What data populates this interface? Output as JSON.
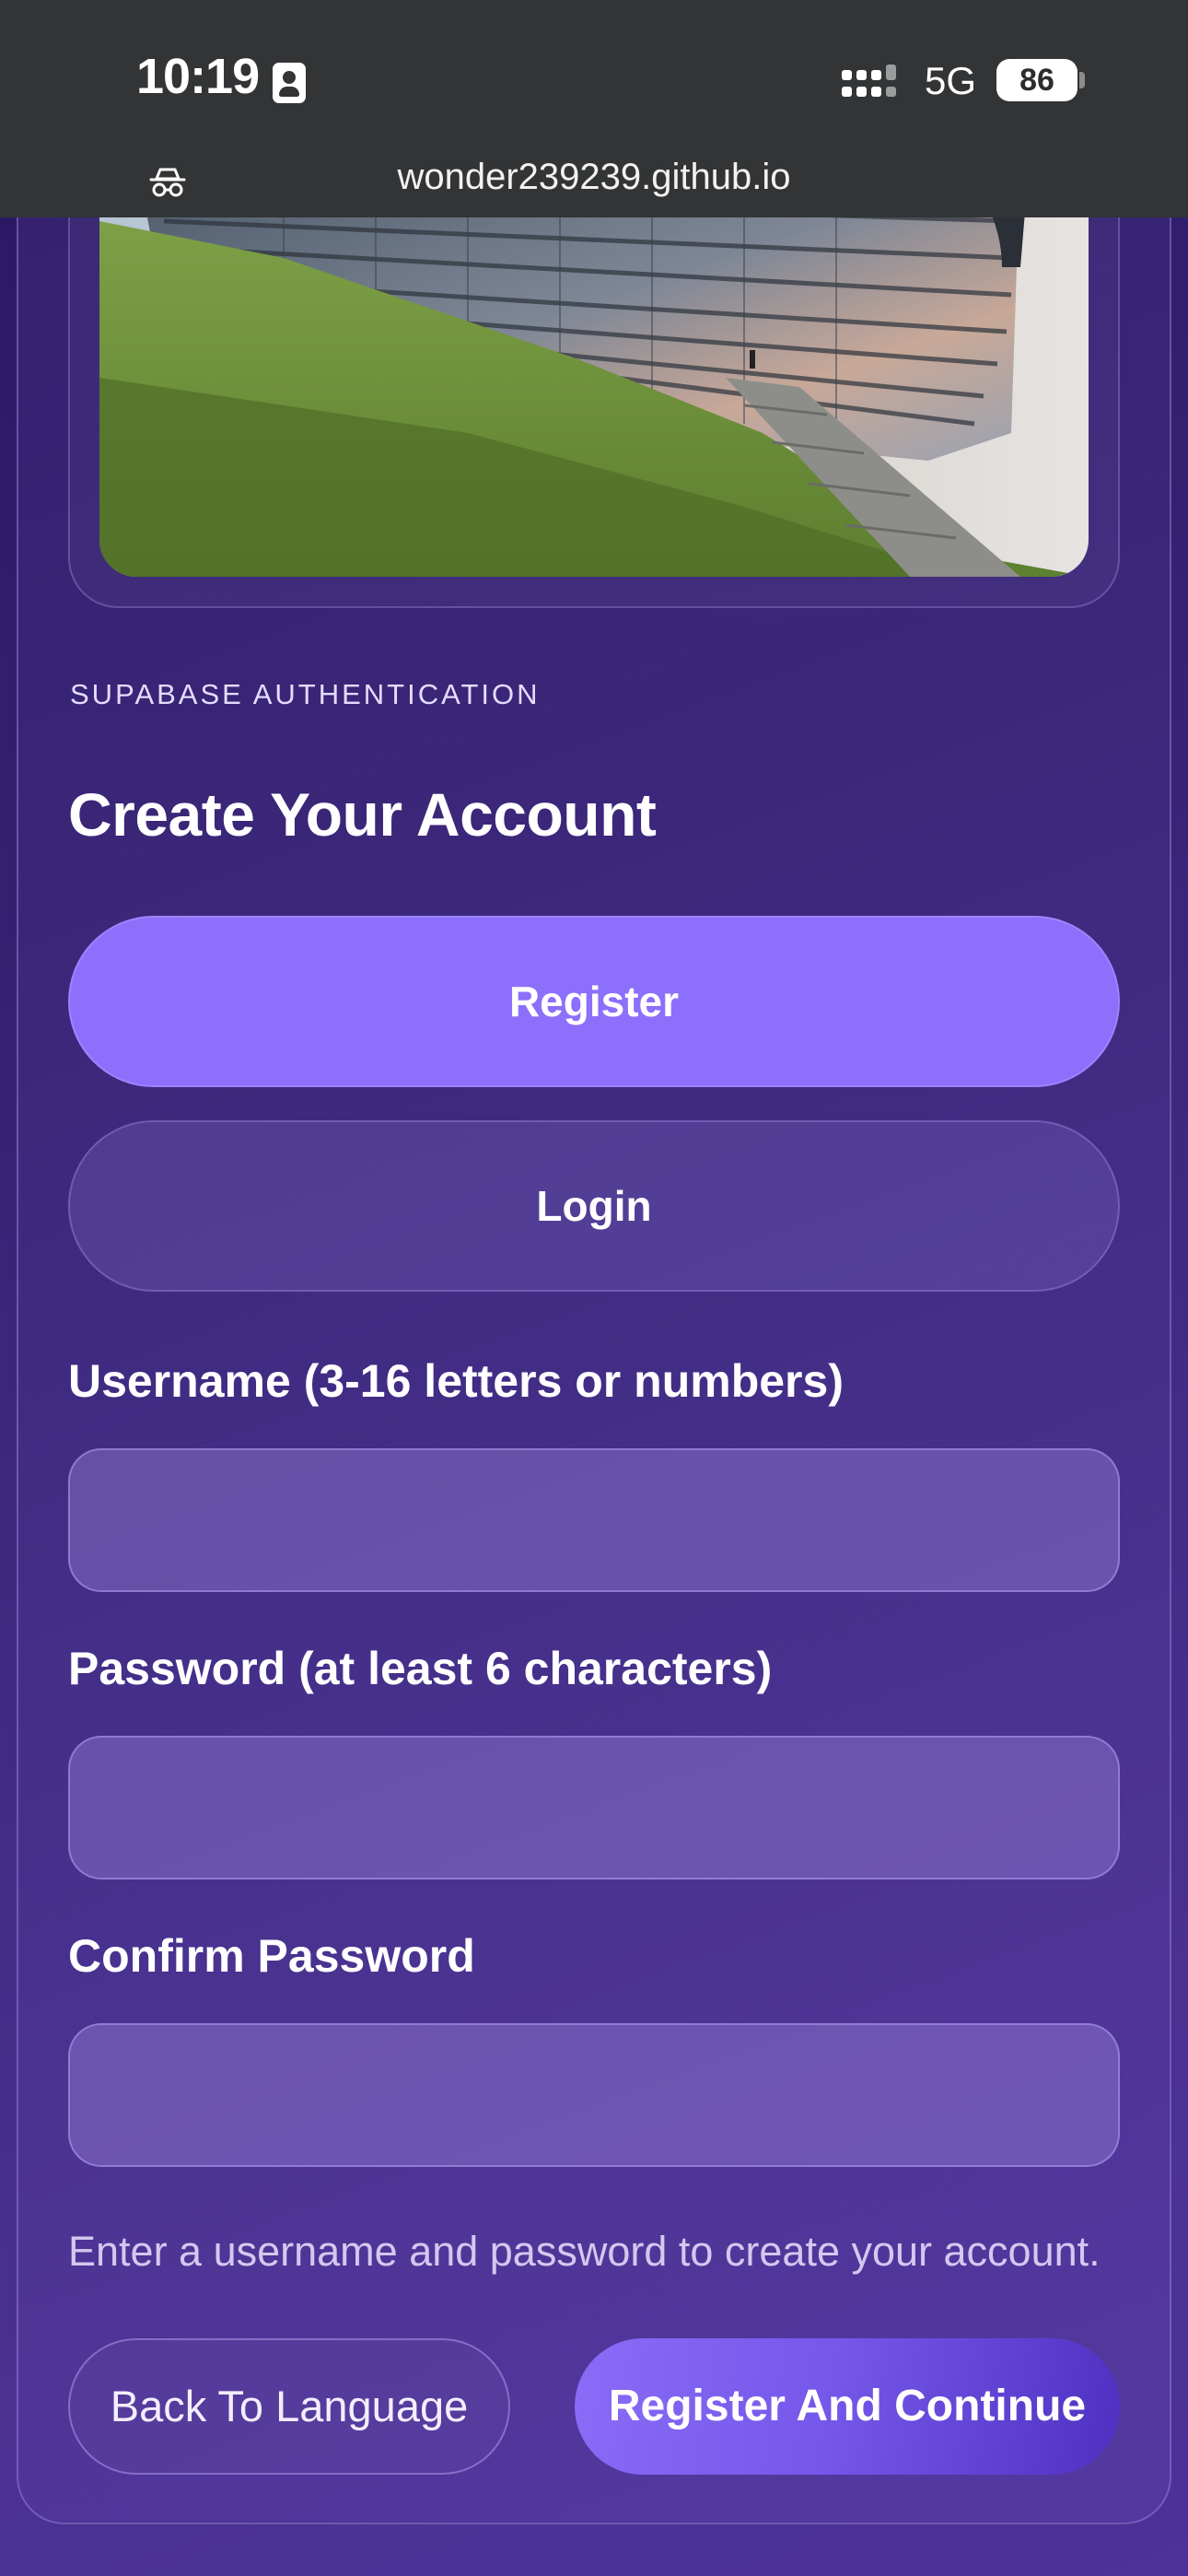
{
  "status_bar": {
    "time": "10:19",
    "network": "5G",
    "battery": "86"
  },
  "browser": {
    "url": "wonder239239.github.io"
  },
  "auth": {
    "eyebrow": "SUPABASE AUTHENTICATION",
    "title": "Create Your Account",
    "tabs": {
      "register": "Register",
      "login": "Login"
    },
    "fields": {
      "username_label": "Username (3-16 letters or numbers)",
      "username_value": "",
      "password_label": "Password (at least 6 characters)",
      "password_value": "",
      "confirm_label": "Confirm Password",
      "confirm_value": ""
    },
    "hint": "Enter a username and password to create your account.",
    "actions": {
      "back": "Back To Language",
      "continue": "Register And Continue"
    }
  },
  "colors": {
    "accent": "#8c6ffb",
    "background": "#34206f",
    "continue_gradient_start": "#8a6cf7",
    "continue_gradient_end": "#4e30c0"
  }
}
